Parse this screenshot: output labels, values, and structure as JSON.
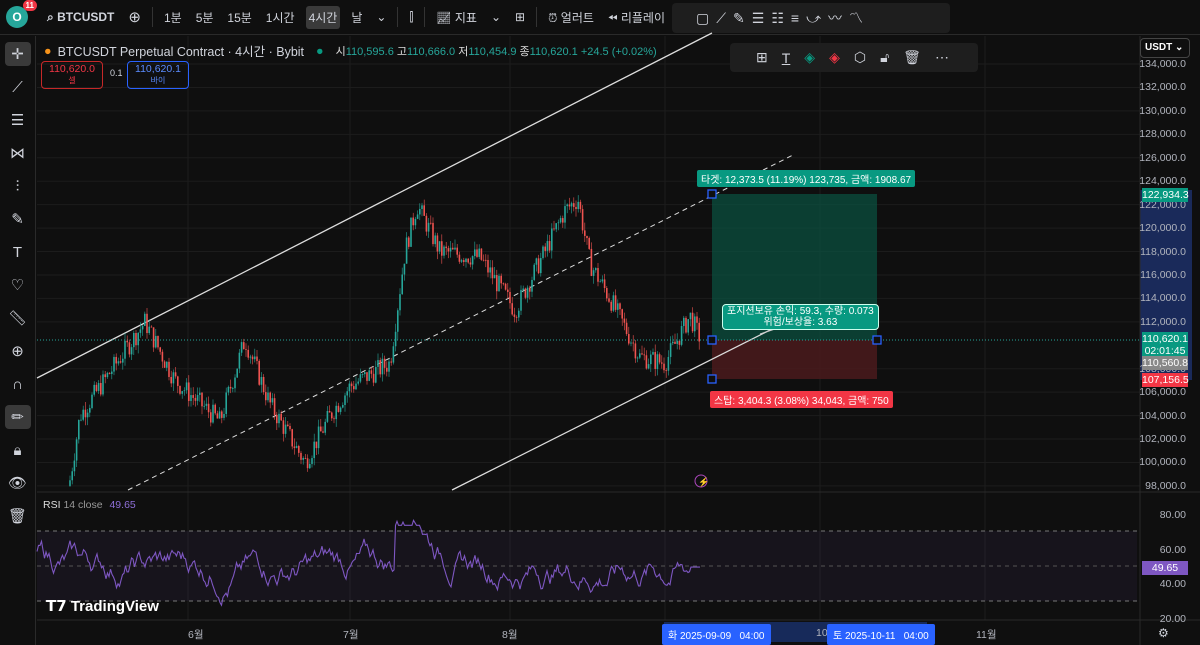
{
  "header": {
    "notif_count": "11",
    "logo": "O",
    "symbol": "BTCUSDT",
    "intervals": [
      "1분",
      "5분",
      "15분",
      "1시간",
      "4시간",
      "날"
    ],
    "active_interval": "4시간",
    "indicators": "지표",
    "alert": "얼러트",
    "replay": "리플레이"
  },
  "legend": {
    "title": "BTCUSDT Perpetual Contract · 4시간 · Bybit",
    "o_label": "시",
    "o": "110,595.6",
    "h_label": "고",
    "h": "110,666.0",
    "l_label": "저",
    "l": "110,454.9",
    "c_label": "종",
    "c": "110,620.1",
    "change": "+24.5 (+0.02%)",
    "sell_price": "110,620.0",
    "sell_label": "셀",
    "spread": "0.1",
    "buy_price": "110,620.1",
    "buy_label": "바이"
  },
  "price_axis": {
    "currency": "USDT",
    "ticks": [
      "134,000.0",
      "132,000.0",
      "130,000.0",
      "128,000.0",
      "126,000.0",
      "124,000.0",
      "122,000.0",
      "120,000.0",
      "118,000.0",
      "116,000.0",
      "114,000.0",
      "112,000.0",
      "108,000.0",
      "106,000.0",
      "104,000.0",
      "102,000.0",
      "100,000.0",
      "98,000.0"
    ],
    "target_price": "122,934.3",
    "last_price": "110,620.1",
    "countdown": "02:01:45",
    "gray_price": "110,560.8",
    "stop_price": "107,156.5"
  },
  "position": {
    "target": "타겟: 12,373.5 (11.19%) 123,735, 금액: 1908.67",
    "info_line1": "포지션보유 손익: 59.3, 수량: 0.073",
    "info_line2": "위험/보상율: 3.63",
    "stop": "스탑: 3,404.3 (3.08%) 34,043, 금액: 750",
    "colors": {
      "profit": "#089981",
      "loss": "#f23645"
    }
  },
  "rsi": {
    "label": "RSI",
    "params": "14 close",
    "value": "49.65",
    "ticks": [
      "80.00",
      "60.00",
      "40.00",
      "20.00"
    ],
    "color": "#7e57c2"
  },
  "time_axis": {
    "labels": [
      "6월",
      "7월",
      "8월",
      "10",
      "11월"
    ],
    "cursor_start": "화 2025-09-09   04:00",
    "cursor_end": "토 2025-10-11   04:00"
  },
  "watermark": "TradingView"
}
